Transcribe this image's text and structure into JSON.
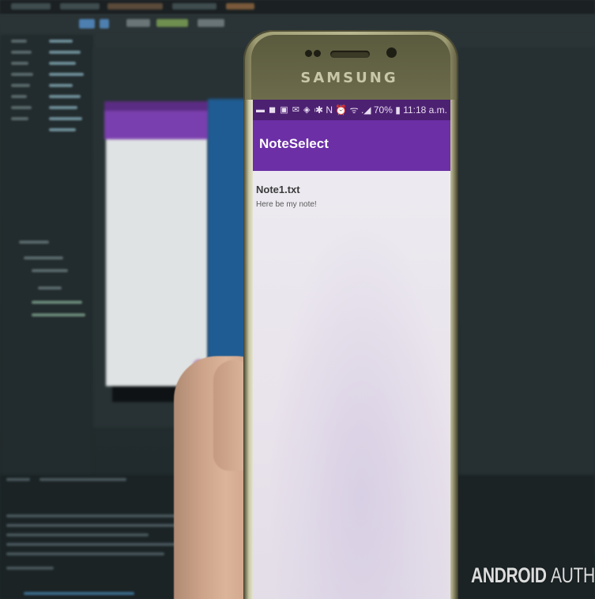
{
  "photo": {
    "device_brand": "SAMSUNG",
    "watermark": {
      "bold": "ANDROID",
      "light": "AUTHORITY"
    }
  },
  "phone": {
    "statusbar": {
      "left_icons": "▬ ◼ ▣ ✉ ◈ ◉ f f f ✕",
      "right_icons": "✱ N ⏰ ᯤ .◢",
      "battery": "70%",
      "time": "11:18 a.m."
    },
    "app": {
      "title": "NoteSelect",
      "notes": [
        {
          "title": "Note1.txt",
          "body": "Here be my note!"
        }
      ]
    }
  },
  "colors": {
    "statusbar": "#4d2172",
    "appbar": "#6c2fa6",
    "ide_preview_blue": "#1f5c93"
  }
}
